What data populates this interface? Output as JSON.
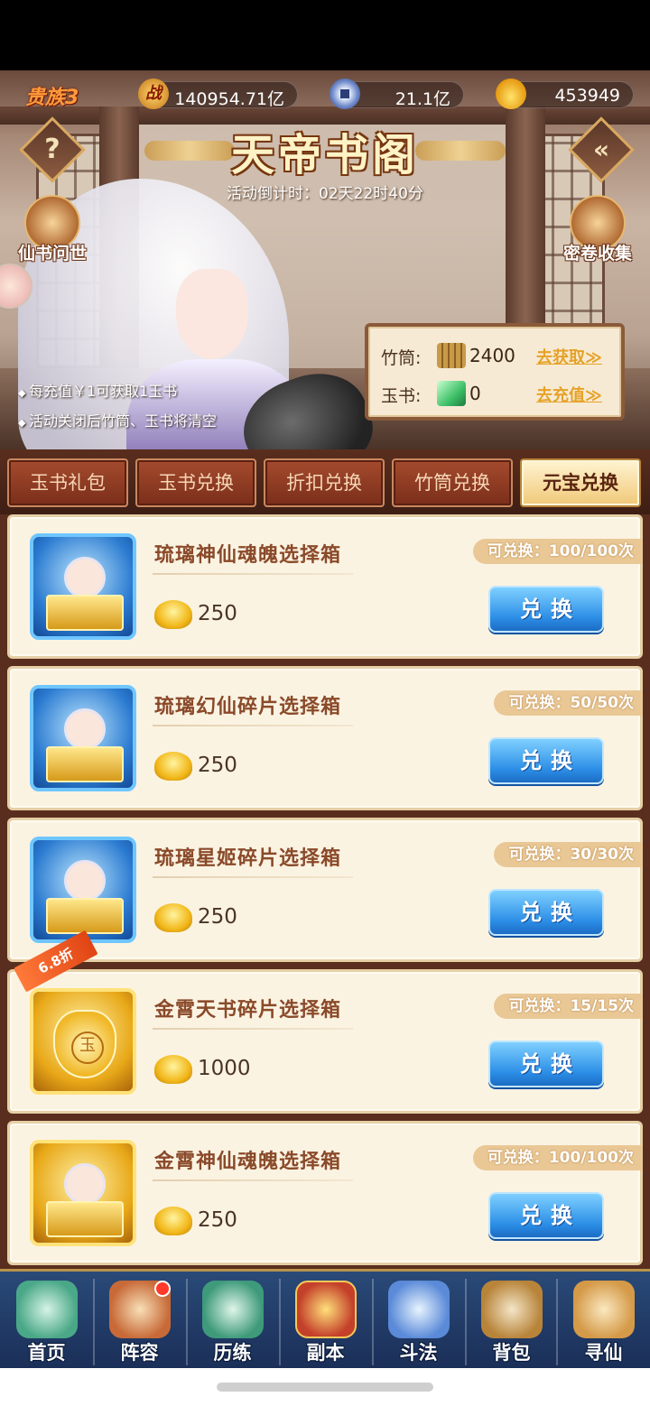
{
  "header": {
    "noble": "贵族3",
    "power_icon": "战",
    "power": "140954.71亿",
    "coins": "21.1亿",
    "ingots": "453949"
  },
  "banner": {
    "title": "天帝书阁",
    "countdown": "活动倒计时：02天22时40分",
    "help_label": "?",
    "back_label": "«",
    "left_button": "仙书问世",
    "right_button": "密卷收集",
    "bullets": [
      "每充值￥1可获取1玉书",
      "活动关闭后竹筒、玉书将清空"
    ]
  },
  "currencies": [
    {
      "label": "竹筒:",
      "icon": "bamboo-scroll-icon",
      "amount": "2400",
      "link": "去获取≫"
    },
    {
      "label": "玉书:",
      "icon": "jade-book-icon",
      "amount": "0",
      "link": "去充值≫"
    }
  ],
  "tabs": [
    {
      "label": "玉书礼包",
      "active": false
    },
    {
      "label": "玉书兑换",
      "active": false
    },
    {
      "label": "折扣兑换",
      "active": false
    },
    {
      "label": "竹筒兑换",
      "active": false
    },
    {
      "label": "元宝兑换",
      "active": true
    }
  ],
  "items": [
    {
      "name": "琉璃神仙魂魄选择箱",
      "price": "250",
      "limit": "可兑换：100/100次",
      "button": "兑换",
      "frame": "blue",
      "discount": ""
    },
    {
      "name": "琉璃幻仙碎片选择箱",
      "price": "250",
      "limit": "可兑换：50/50次",
      "button": "兑换",
      "frame": "blue",
      "discount": ""
    },
    {
      "name": "琉璃星姬碎片选择箱",
      "price": "250",
      "limit": "可兑换：30/30次",
      "button": "兑换",
      "frame": "blue",
      "discount": ""
    },
    {
      "name": "金霄天书碎片选择箱",
      "price": "1000",
      "limit": "可兑换：15/15次",
      "button": "兑换",
      "frame": "gold",
      "discount": "6.8折"
    },
    {
      "name": "金霄神仙魂魄选择箱",
      "price": "250",
      "limit": "可兑换：100/100次",
      "button": "兑换",
      "frame": "gold",
      "discount": ""
    }
  ],
  "nav": [
    {
      "label": "首页",
      "icon": "home-icon"
    },
    {
      "label": "阵容",
      "icon": "lineup-icon",
      "badge": true
    },
    {
      "label": "历练",
      "icon": "training-icon"
    },
    {
      "label": "副本",
      "icon": "dungeon-icon"
    },
    {
      "label": "斗法",
      "icon": "battle-icon"
    },
    {
      "label": "背包",
      "icon": "bag-icon"
    },
    {
      "label": "寻仙",
      "icon": "seek-immortal-icon"
    }
  ]
}
